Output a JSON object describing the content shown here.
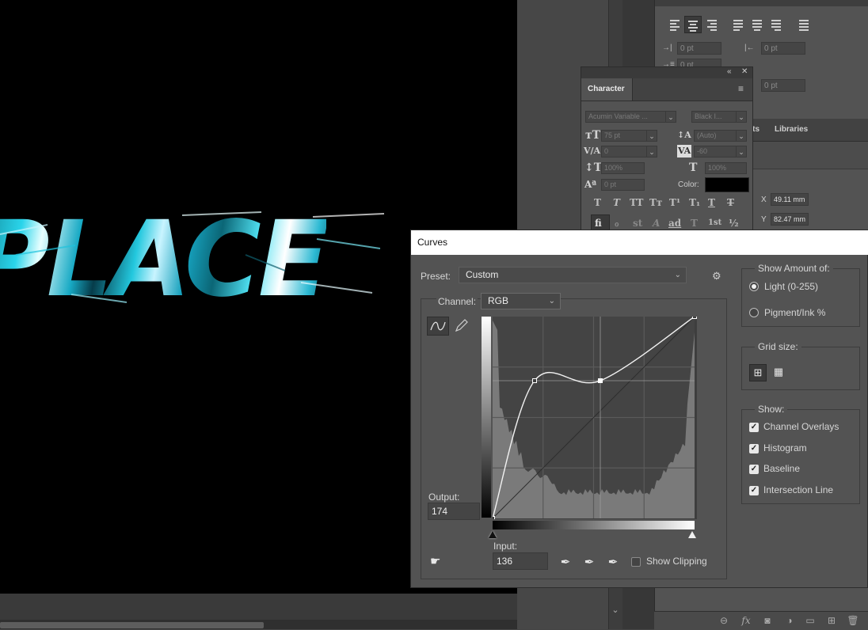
{
  "canvas": {
    "text": "PLACE"
  },
  "properties_panel": {
    "indent_values": [
      "0 pt",
      "0 pt",
      "0 pt"
    ],
    "extra_value": "0 pt",
    "tabs": [
      "nts",
      "Libraries"
    ],
    "x_label": "X",
    "x_value": "49.11 mm",
    "y_label": "Y",
    "y_value": "82.47 mm",
    "bottom_icons": [
      "link-icon",
      "fx-icon",
      "mask-icon",
      "adjustment-icon",
      "folder-icon",
      "new-layer-icon",
      "trash-icon"
    ]
  },
  "character_panel": {
    "tab": "Character",
    "font_family": "Acumin Variable ...",
    "font_style": "Black I...",
    "font_size": "75 pt",
    "leading": "(Auto)",
    "kerning": "0",
    "tracking": "-60",
    "vertical_scale": "100%",
    "horizontal_scale": "100%",
    "baseline_shift": "0 pt",
    "color_label": "Color:",
    "color_value": "#000000",
    "style_buttons": [
      "T",
      "T",
      "TT",
      "Tт",
      "T¹",
      "T₁",
      "T",
      "T"
    ],
    "opentype_buttons": [
      "fi",
      "ℴ",
      "st",
      "A",
      "ad",
      "T",
      "1st",
      "½"
    ]
  },
  "curves": {
    "title": "Curves",
    "preset_label": "Preset:",
    "preset_value": "Custom",
    "channel_label": "Channel:",
    "channel_value": "RGB",
    "output_label": "Output:",
    "output_value": "174",
    "input_label": "Input:",
    "input_value": "136",
    "show_clipping": "Show Clipping",
    "show_clipping_checked": false,
    "show_amount_title": "Show Amount of:",
    "light_option": "Light  (0-255)",
    "pigment_option": "Pigment/Ink %",
    "selected_amount": "light",
    "grid_size_title": "Grid size:",
    "show_title": "Show:",
    "show_options": [
      {
        "label": "Channel Overlays",
        "checked": true
      },
      {
        "label": "Histogram",
        "checked": true
      },
      {
        "label": "Baseline",
        "checked": true
      },
      {
        "label": "Intersection Line",
        "checked": true
      }
    ],
    "curve_points": [
      [
        0,
        0
      ],
      [
        53,
        174
      ],
      [
        136,
        174
      ],
      [
        255,
        255
      ]
    ]
  }
}
